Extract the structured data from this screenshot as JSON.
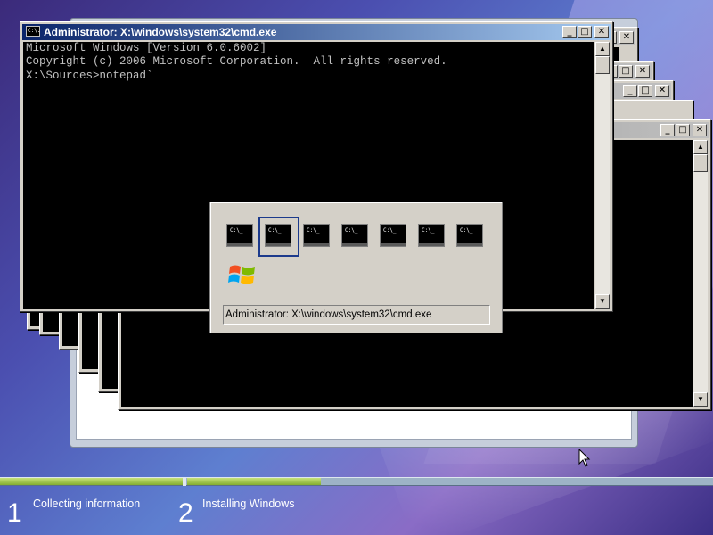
{
  "main_window": {
    "title": "Administrator: X:\\windows\\system32\\cmd.exe",
    "icon_text": "C:\\.",
    "console_lines": [
      "Microsoft Windows [Version 6.0.6002]",
      "Copyright (c) 2006 Microsoft Corporation.  All rights reserved.",
      "",
      "X:\\Sources>notepad`"
    ]
  },
  "titlebar_buttons": {
    "minimize": "_",
    "maximize": "□",
    "close": "✕"
  },
  "switcher": {
    "selected_label": "Administrator: X:\\windows\\system32\\cmd.exe",
    "icon_glyph": "C:\\_",
    "icons": [
      {
        "name": "cmd-1",
        "selected": false
      },
      {
        "name": "cmd-2",
        "selected": true
      },
      {
        "name": "cmd-3",
        "selected": false
      },
      {
        "name": "cmd-4",
        "selected": false
      },
      {
        "name": "cmd-5",
        "selected": false
      },
      {
        "name": "cmd-6",
        "selected": false
      },
      {
        "name": "cmd-7",
        "selected": false
      }
    ],
    "extra_icon": "windows-logo-icon"
  },
  "setup_progress": {
    "steps": [
      {
        "number": "1",
        "label": "Collecting information"
      },
      {
        "number": "2",
        "label": "Installing Windows"
      }
    ],
    "accent_color": "#8ab83a"
  }
}
